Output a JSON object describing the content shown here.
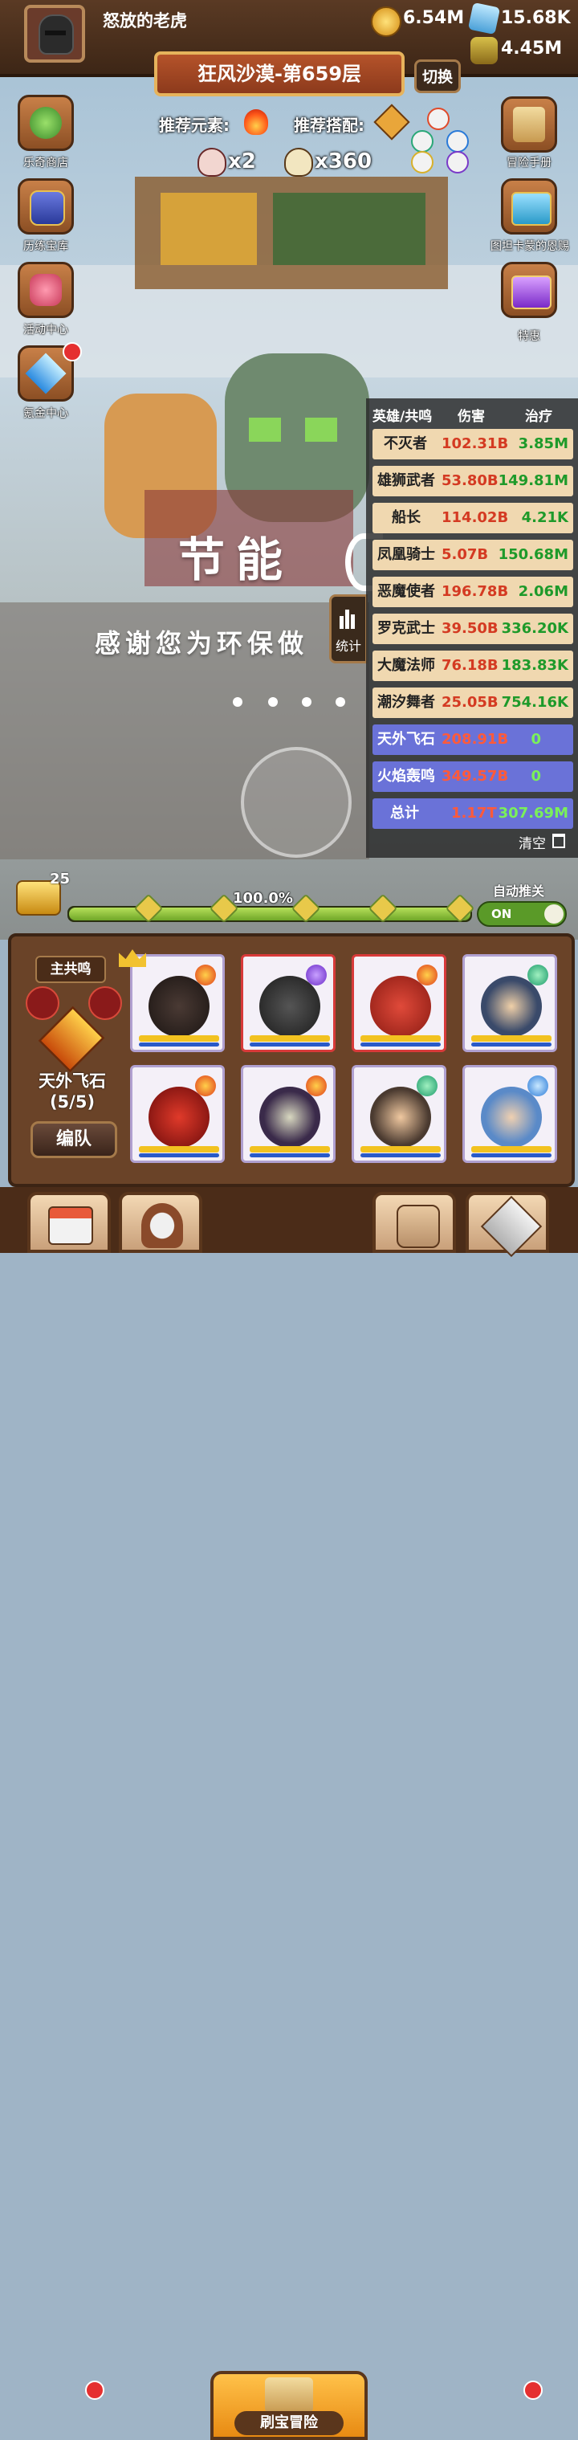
{
  "player": {
    "name": "怒放的老虎"
  },
  "resources": {
    "gold": "6.54M",
    "crystal": "15.68K",
    "potion": "4.45M"
  },
  "level": {
    "title": "狂风沙漠-第659层",
    "switch_label": "切换"
  },
  "recommend": {
    "element_label": "推荐元素:",
    "combo_label": "推荐搭配:"
  },
  "skulls": [
    {
      "count": "x2"
    },
    {
      "count": "x360"
    }
  ],
  "left_menu": [
    {
      "label": "乐奇商店"
    },
    {
      "label": "历练宝库"
    },
    {
      "label": "活动中心"
    },
    {
      "label": "氪金中心"
    }
  ],
  "right_menu": [
    {
      "label": "冒险手册"
    },
    {
      "label": "图坦卡蒙的恩赐"
    },
    {
      "label": "特惠"
    }
  ],
  "overlay": {
    "title": "节能",
    "subtitle": "感谢您为环保做"
  },
  "stats": {
    "headers": {
      "hero": "英雄/共鸣",
      "damage": "伤害",
      "heal": "治疗"
    },
    "rows": [
      {
        "name": "不灭者",
        "damage": "102.31B",
        "heal": "3.85M",
        "type": "hero"
      },
      {
        "name": "雄狮武者",
        "damage": "53.80B",
        "heal": "149.81M",
        "type": "hero"
      },
      {
        "name": "船长",
        "damage": "114.02B",
        "heal": "4.21K",
        "type": "hero"
      },
      {
        "name": "凤凰骑士",
        "damage": "5.07B",
        "heal": "150.68M",
        "type": "hero"
      },
      {
        "name": "恶魔使者",
        "damage": "196.78B",
        "heal": "2.06M",
        "type": "hero"
      },
      {
        "name": "罗克武士",
        "damage": "39.50B",
        "heal": "336.20K",
        "type": "hero"
      },
      {
        "name": "大魔法师",
        "damage": "76.18B",
        "heal": "183.83K",
        "type": "hero"
      },
      {
        "name": "潮汐舞者",
        "damage": "25.05B",
        "heal": "754.16K",
        "type": "hero"
      },
      {
        "name": "天外飞石",
        "damage": "208.91B",
        "heal": "0",
        "type": "resonance"
      },
      {
        "name": "火焰轰鸣",
        "damage": "349.57B",
        "heal": "0",
        "type": "resonance"
      },
      {
        "name": "总计",
        "damage": "1.17T",
        "heal": "307.69M",
        "type": "total"
      }
    ],
    "clear_label": "清空",
    "tab_label": "统计"
  },
  "chest": {
    "count": "25"
  },
  "progress": {
    "label": "100.0%",
    "value": 100
  },
  "auto": {
    "label": "自动推关",
    "toggle": "ON"
  },
  "team": {
    "main_resonance_label": "主共鸣",
    "resonance_name": "天外飞石",
    "resonance_count": "(5/5)",
    "formation_button": "编队"
  },
  "nav": {
    "adventure_label": "刷宝冒险"
  }
}
